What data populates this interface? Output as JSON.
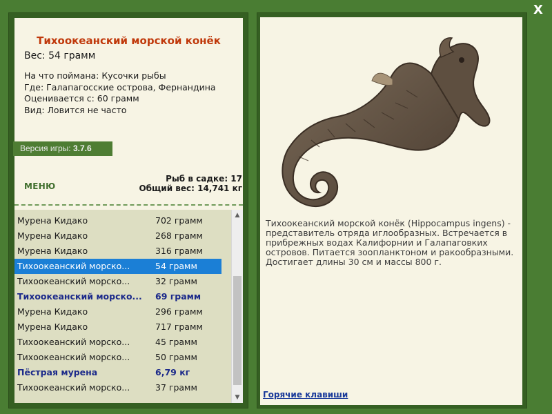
{
  "window": {
    "close_glyph": "X"
  },
  "fish_info": {
    "title": "Тихоокеанский морской конёк",
    "weight_line": "Вес: 54 грамм",
    "details": [
      "На что поймана: Кусочки рыбы",
      "Где: Галапагосские острова, Фернандина",
      "Оценивается с: 60 грамм",
      "Вид: Ловится не часто"
    ]
  },
  "version": {
    "label": "Версия игры:",
    "value": "3.7.6"
  },
  "menu": {
    "label": "МЕНЮ"
  },
  "stats": {
    "fish_in_keepnet": "Рыб в садке: 17",
    "total_weight": "Общий вес: 14,741 кг"
  },
  "catch_list": [
    {
      "name": "Мурена Кидако",
      "weight": "702 грамм",
      "style": "normal"
    },
    {
      "name": "Мурена Кидако",
      "weight": "268 грамм",
      "style": "normal"
    },
    {
      "name": "Мурена Кидако",
      "weight": "316 грамм",
      "style": "normal"
    },
    {
      "name": "Тихоокеанский морско...",
      "weight": "54 грамм",
      "style": "selected"
    },
    {
      "name": "Тихоокеанский морско...",
      "weight": "32 грамм",
      "style": "normal"
    },
    {
      "name": "Тихоокеанский морско...",
      "weight": "69 грамм",
      "style": "bold"
    },
    {
      "name": "Мурена Кидако",
      "weight": "296 грамм",
      "style": "normal"
    },
    {
      "name": "Мурена Кидако",
      "weight": "717 грамм",
      "style": "normal"
    },
    {
      "name": "Тихоокеанский морско...",
      "weight": "45 грамм",
      "style": "normal"
    },
    {
      "name": "Тихоокеанский морско...",
      "weight": "50 грамм",
      "style": "normal"
    },
    {
      "name": "Пёстрая мурена",
      "weight": "6,79 кг",
      "style": "bold"
    },
    {
      "name": "Тихоокеанский морско...",
      "weight": "37 грамм",
      "style": "normal"
    }
  ],
  "description": {
    "text": "Тихоокеанский морской конёк (Hippocampus ingens) - представитель отряда иглообразных. Встречается в прибрежных водах Калифорнии и Галапаговких островов. Питается зоопланктоном и ракообразными. Достигает длины 30 см и массы 800 г.",
    "illustration_icon": "seahorse-illustration"
  },
  "hotkeys": {
    "label": "Горячие клавиши"
  },
  "colors": {
    "background": "#4a7d33",
    "panel": "#355f22",
    "card": "#f7f4e4",
    "list_bg": "#dddec2",
    "title_red": "#c0390b",
    "selection_blue": "#1b7fd6",
    "bold_row_blue": "#1c2a8a",
    "link_blue": "#1a3a9a",
    "version_green": "#4e7d33"
  }
}
